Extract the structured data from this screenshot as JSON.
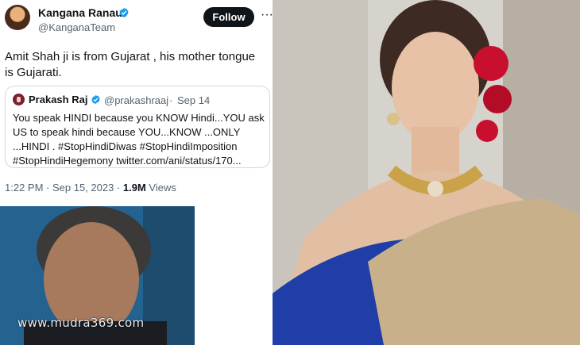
{
  "tweet": {
    "author_name": "Kangana Ranaut",
    "author_handle": "@KanganaTeam",
    "follow_label": "Follow",
    "more_glyph": "···",
    "text": "Amit Shah ji is from Gujarat , his mother tongue is Gujarati.",
    "timestamp": "1:22 PM · Sep 15, 2023 ·",
    "views_count": "1.9M",
    "views_label": "Views"
  },
  "quoted_tweet": {
    "author_name": "Prakash Raj",
    "author_handle": "@prakashraaj",
    "separator": "·",
    "date": "Sep 14",
    "text": "You speak HINDI because you KNOW Hindi...YOU ask US to speak hindi because YOU...KNOW ...ONLY ...HINDI . #StopHindiDiwas  #StopHindiImposition #StopHindiHegemony twitter.com/ani/status/170..."
  },
  "watermark": "www.mudra369.com",
  "colors": {
    "verified": "#1d9bf0",
    "follow_bg": "#0f1419",
    "secondary_text": "#536471",
    "border": "#cfd9de"
  }
}
